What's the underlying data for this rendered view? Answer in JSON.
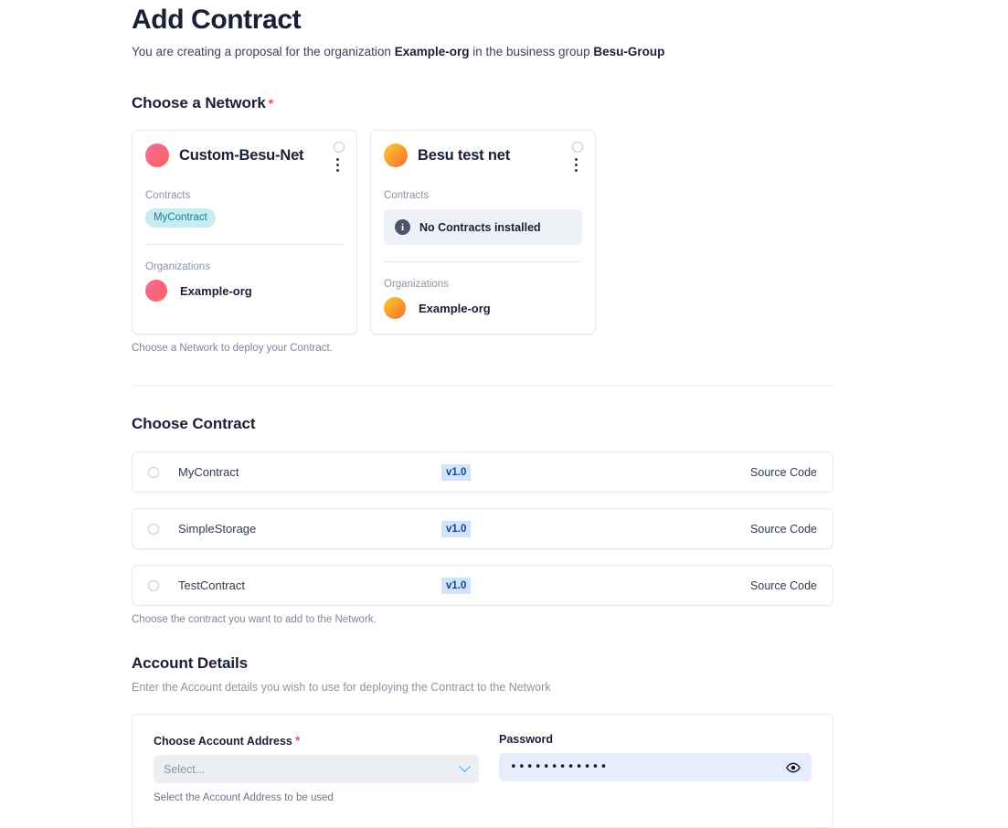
{
  "header": {
    "title": "Add Contract",
    "subtitle_pre": "You are creating a proposal for the organization ",
    "subtitle_org": "Example-org",
    "subtitle_mid": " in the business group ",
    "subtitle_group": "Besu-Group"
  },
  "network_section": {
    "heading": "Choose a Network",
    "required_mark": "*",
    "helper": "Choose a Network to deploy your Contract.",
    "cards": [
      {
        "name": "Custom-Besu-Net",
        "avatar_color": "#f8647a",
        "contracts_label": "Contracts",
        "contract_chip": "MyContract",
        "organizations_label": "Organizations",
        "org_name": "Example-org",
        "selected": false
      },
      {
        "name": "Besu test net",
        "avatar_color": "#fba12a",
        "contracts_label": "Contracts",
        "empty_message": "No Contracts installed",
        "organizations_label": "Organizations",
        "org_name": "Example-org",
        "selected": false
      }
    ]
  },
  "contract_section": {
    "heading": "Choose Contract",
    "helper": "Choose the contract you want to add to the Network.",
    "rows": [
      {
        "name": "MyContract",
        "version": "v1.0",
        "source_link": "Source Code",
        "selected": false
      },
      {
        "name": "SimpleStorage",
        "version": "v1.0",
        "source_link": "Source Code",
        "selected": false
      },
      {
        "name": "TestContract",
        "version": "v1.0",
        "source_link": "Source Code",
        "selected": false
      }
    ]
  },
  "account_section": {
    "heading": "Account Details",
    "subtitle": "Enter the Account details you wish to use for deploying the Contract to the Network",
    "address_label": "Choose Account Address",
    "address_required": "*",
    "address_placeholder": "Select...",
    "address_helper": "Select the Account Address to be used",
    "password_label": "Password",
    "password_value": "••••••••••••"
  },
  "colors": {
    "accent_blue": "#3b9df5",
    "required_red": "#f05252",
    "chip_cyan_bg": "#c7ecf2",
    "chip_cyan_text": "#1a7f92",
    "version_bg": "#cfe3fa",
    "version_text": "#17478e"
  }
}
